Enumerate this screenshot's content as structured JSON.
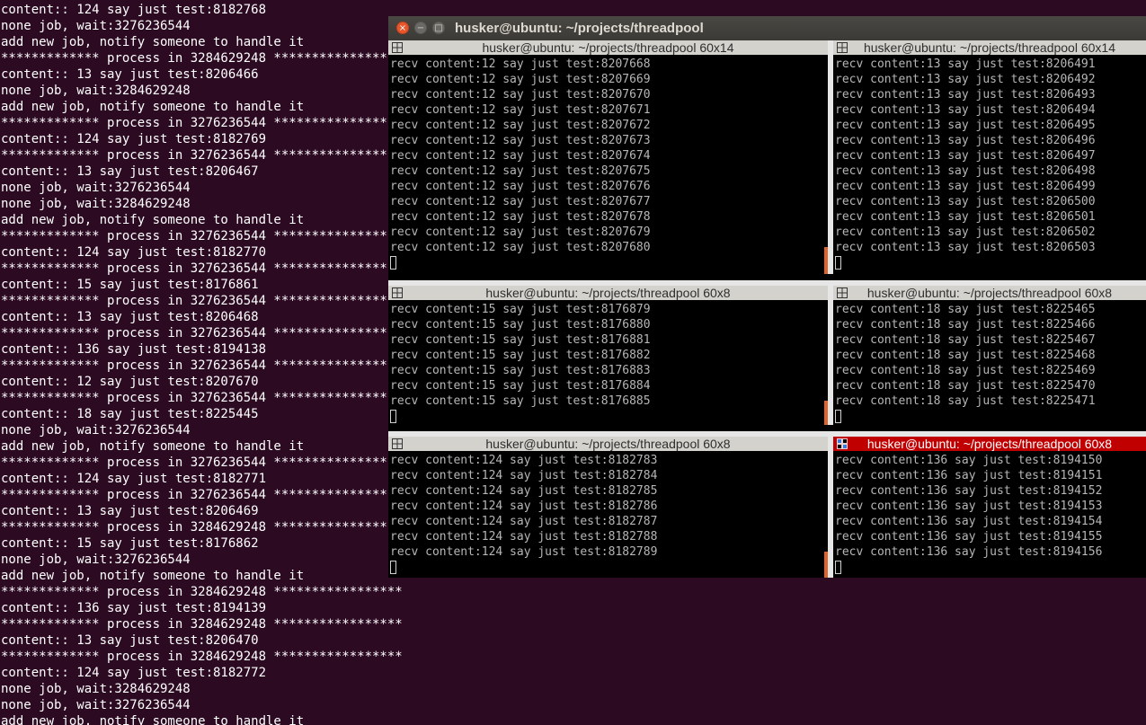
{
  "background_terminal": {
    "lines": [
      "content:: 124 say just test:8182768",
      "none job, wait:3276236544",
      "add new job, notify someone to handle it",
      "************* process in 3284629248 *****************",
      "content:: 13 say just test:8206466",
      "none job, wait:3284629248",
      "add new job, notify someone to handle it",
      "************* process in 3276236544 *****************",
      "content:: 124 say just test:8182769",
      "************* process in 3276236544 *****************",
      "content:: 13 say just test:8206467",
      "none job, wait:3276236544",
      "none job, wait:3284629248",
      "add new job, notify someone to handle it",
      "************* process in 3276236544 *****************",
      "content:: 124 say just test:8182770",
      "************* process in 3276236544 *****************",
      "content:: 15 say just test:8176861",
      "************* process in 3276236544 *****************",
      "content:: 13 say just test:8206468",
      "************* process in 3276236544 *****************",
      "content:: 136 say just test:8194138",
      "************* process in 3276236544 *****************",
      "content:: 12 say just test:8207670",
      "************* process in 3276236544 *****************",
      "content:: 18 say just test:8225445",
      "none job, wait:3276236544",
      "add new job, notify someone to handle it",
      "************* process in 3276236544 *****************",
      "content:: 124 say just test:8182771",
      "************* process in 3276236544 *****************",
      "content:: 13 say just test:8206469",
      "************* process in 3284629248 *****************",
      "content:: 15 say just test:8176862",
      "none job, wait:3276236544",
      "add new job, notify someone to handle it",
      "************* process in 3284629248 *****************",
      "content:: 136 say just test:8194139",
      "************* process in 3284629248 *****************",
      "content:: 13 say just test:8206470",
      "************* process in 3284629248 *****************",
      "content:: 124 say just test:8182772",
      "none job, wait:3284629248",
      "none job, wait:3276236544",
      "add new job, notify someone to handle it"
    ]
  },
  "window": {
    "title": "husker@ubuntu: ~/projects/threadpool",
    "buttons": {
      "close": "×",
      "minimize": "−",
      "maximize": "□"
    }
  },
  "panes": [
    {
      "title": "husker@ubuntu: ~/projects/threadpool 60x14",
      "active": false,
      "lines": [
        "recv content:12 say just test:8207668",
        "recv content:12 say just test:8207669",
        "recv content:12 say just test:8207670",
        "recv content:12 say just test:8207671",
        "recv content:12 say just test:8207672",
        "recv content:12 say just test:8207673",
        "recv content:12 say just test:8207674",
        "recv content:12 say just test:8207675",
        "recv content:12 say just test:8207676",
        "recv content:12 say just test:8207677",
        "recv content:12 say just test:8207678",
        "recv content:12 say just test:8207679",
        "recv content:12 say just test:8207680"
      ]
    },
    {
      "title": "husker@ubuntu: ~/projects/threadpool 60x14",
      "active": false,
      "lines": [
        "recv content:13 say just test:8206491",
        "recv content:13 say just test:8206492",
        "recv content:13 say just test:8206493",
        "recv content:13 say just test:8206494",
        "recv content:13 say just test:8206495",
        "recv content:13 say just test:8206496",
        "recv content:13 say just test:8206497",
        "recv content:13 say just test:8206498",
        "recv content:13 say just test:8206499",
        "recv content:13 say just test:8206500",
        "recv content:13 say just test:8206501",
        "recv content:13 say just test:8206502",
        "recv content:13 say just test:8206503"
      ]
    },
    {
      "title": "husker@ubuntu: ~/projects/threadpool 60x8",
      "active": false,
      "lines": [
        "recv content:15 say just test:8176879",
        "recv content:15 say just test:8176880",
        "recv content:15 say just test:8176881",
        "recv content:15 say just test:8176882",
        "recv content:15 say just test:8176883",
        "recv content:15 say just test:8176884",
        "recv content:15 say just test:8176885"
      ]
    },
    {
      "title": "husker@ubuntu: ~/projects/threadpool 60x8",
      "active": false,
      "lines": [
        "recv content:18 say just test:8225465",
        "recv content:18 say just test:8225466",
        "recv content:18 say just test:8225467",
        "recv content:18 say just test:8225468",
        "recv content:18 say just test:8225469",
        "recv content:18 say just test:8225470",
        "recv content:18 say just test:8225471"
      ]
    },
    {
      "title": "husker@ubuntu: ~/projects/threadpool 60x8",
      "active": false,
      "lines": [
        "recv content:124 say just test:8182783",
        "recv content:124 say just test:8182784",
        "recv content:124 say just test:8182785",
        "recv content:124 say just test:8182786",
        "recv content:124 say just test:8182787",
        "recv content:124 say just test:8182788",
        "recv content:124 say just test:8182789"
      ]
    },
    {
      "title": "husker@ubuntu: ~/projects/threadpool 60x8",
      "active": true,
      "lines": [
        "recv content:136 say just test:8194150",
        "recv content:136 say just test:8194151",
        "recv content:136 say just test:8194152",
        "recv content:136 say just test:8194153",
        "recv content:136 say just test:8194154",
        "recv content:136 say just test:8194155",
        "recv content:136 say just test:8194156"
      ]
    }
  ],
  "colors": {
    "desktop_bg": "#2c0a22",
    "active_pane_header": "#c00000",
    "inactive_pane_header": "#d4d2cd",
    "scroll_indicator": "#e0642c"
  },
  "icons": [
    "terminal-pane-icon",
    "close-icon",
    "minimize-icon",
    "maximize-icon"
  ]
}
